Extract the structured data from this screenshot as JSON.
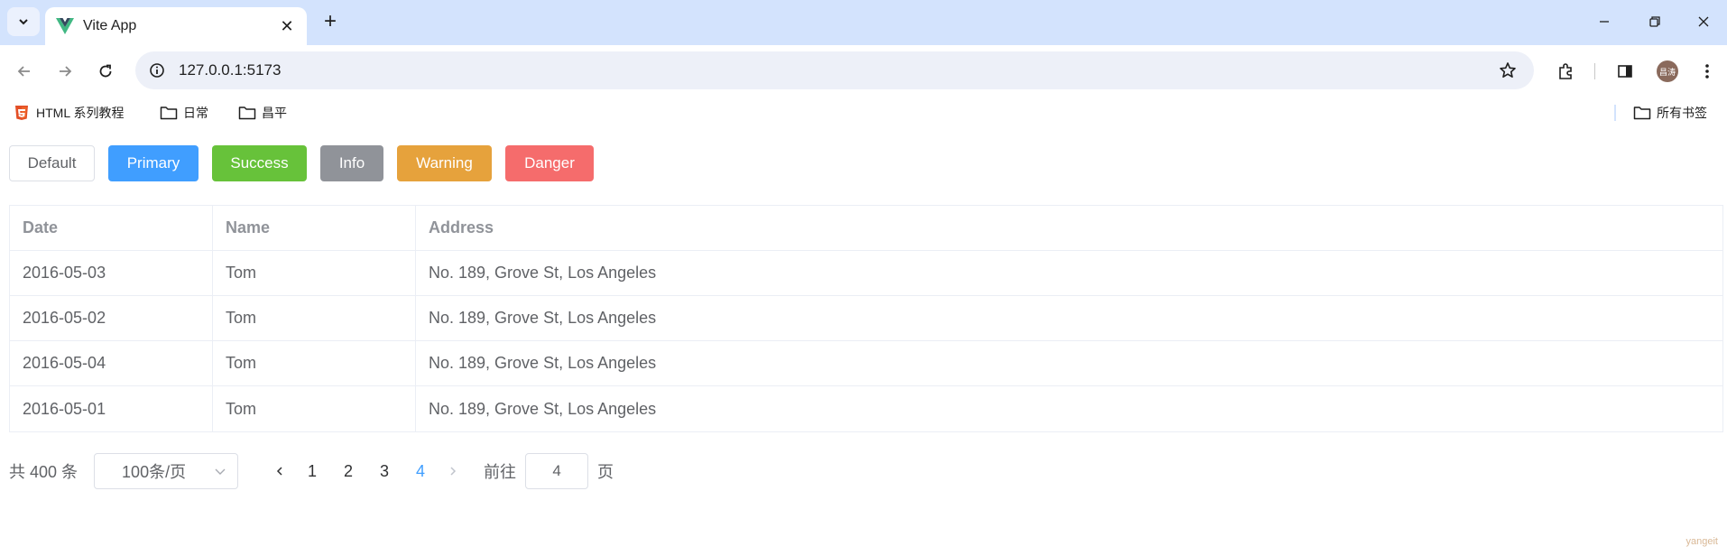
{
  "browser": {
    "tab_title": "Vite App",
    "url": "127.0.0.1:5173",
    "avatar_text": "昌涛",
    "bookmarks": [
      {
        "label": "HTML 系列教程",
        "icon": "html5-icon"
      },
      {
        "label": "日常",
        "icon": "folder-icon"
      },
      {
        "label": "昌平",
        "icon": "folder-icon"
      }
    ],
    "all_bookmarks_label": "所有书签"
  },
  "buttons": [
    {
      "label": "Default",
      "type": "default",
      "color": "#ffffff"
    },
    {
      "label": "Primary",
      "type": "primary",
      "color": "#409eff"
    },
    {
      "label": "Success",
      "type": "success",
      "color": "#67c23a"
    },
    {
      "label": "Info",
      "type": "info",
      "color": "#909399"
    },
    {
      "label": "Warning",
      "type": "warning",
      "color": "#e6a23c"
    },
    {
      "label": "Danger",
      "type": "danger",
      "color": "#f56c6c"
    }
  ],
  "table": {
    "columns": [
      "Date",
      "Name",
      "Address"
    ],
    "rows": [
      [
        "2016-05-03",
        "Tom",
        "No. 189, Grove St, Los Angeles"
      ],
      [
        "2016-05-02",
        "Tom",
        "No. 189, Grove St, Los Angeles"
      ],
      [
        "2016-05-04",
        "Tom",
        "No. 189, Grove St, Los Angeles"
      ],
      [
        "2016-05-01",
        "Tom",
        "No. 189, Grove St, Los Angeles"
      ]
    ]
  },
  "pagination": {
    "total_text": "共 400 条",
    "page_size": "100条/页",
    "pages": [
      "1",
      "2",
      "3",
      "4"
    ],
    "current_page": "4",
    "goto_label": "前往",
    "goto_value": "4",
    "page_suffix": "页"
  },
  "watermark": "yangeit"
}
